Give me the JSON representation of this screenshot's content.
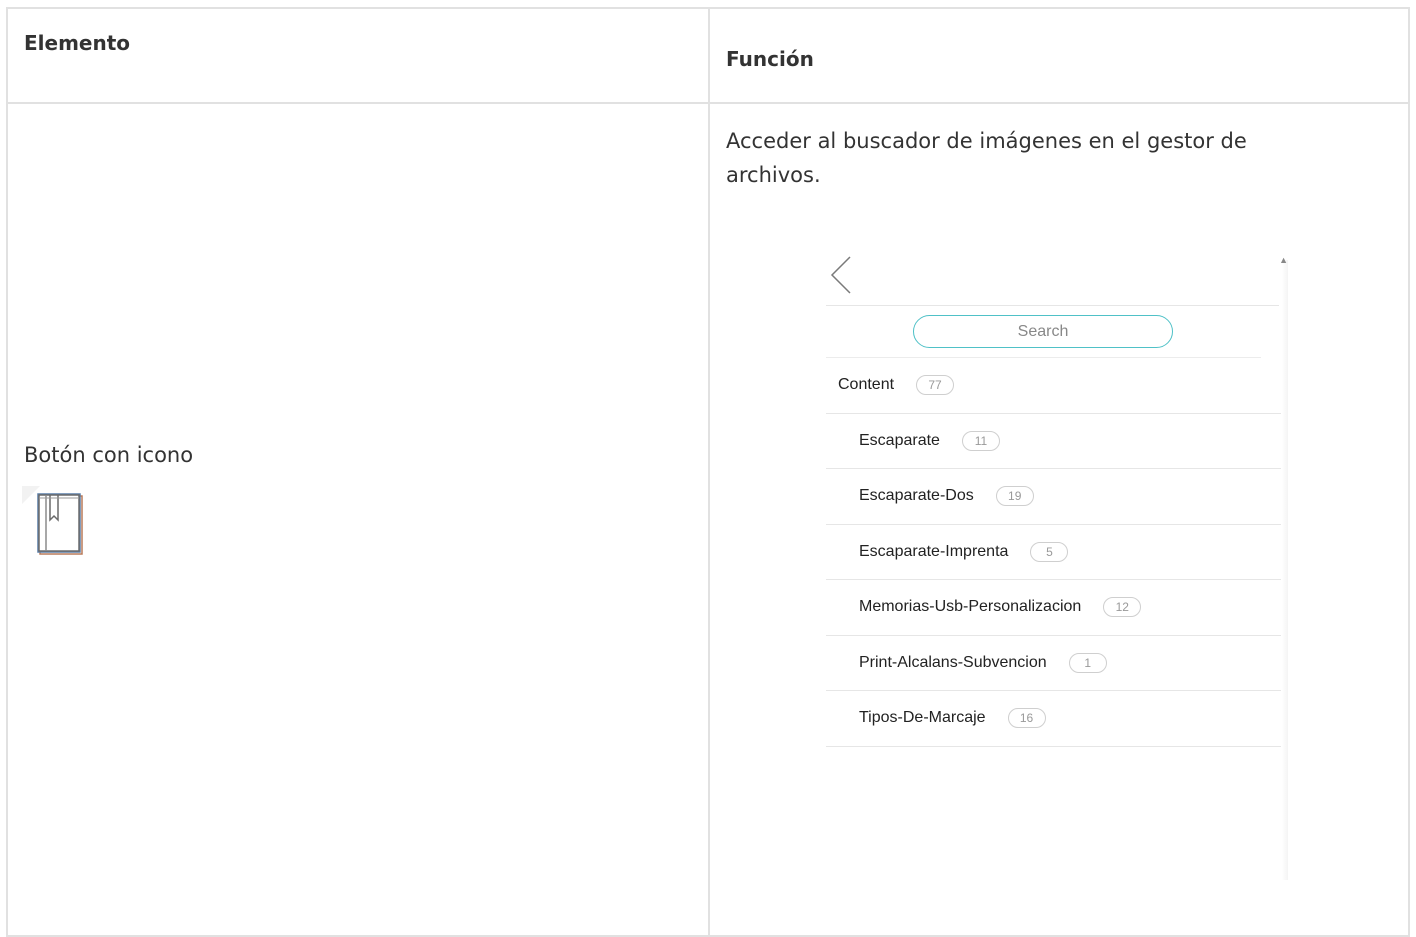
{
  "table": {
    "header_elemento": "Elemento",
    "header_funcion": "Función"
  },
  "row": {
    "elemento_label": "Botón con icono",
    "elemento_icon": "bookmark-book-icon",
    "funcion_text": "Acceder al buscador de imágenes en el gestor de archivos."
  },
  "file_manager": {
    "back_icon": "chevron-left-icon",
    "search": {
      "placeholder": "Search",
      "value": "Search"
    },
    "folders": [
      {
        "name": "Content",
        "count": "77",
        "level": "root"
      },
      {
        "name": "Escaparate",
        "count": "11",
        "level": "child"
      },
      {
        "name": "Escaparate-Dos",
        "count": "19",
        "level": "child"
      },
      {
        "name": "Escaparate-Imprenta",
        "count": "5",
        "level": "child"
      },
      {
        "name": "Memorias-Usb-Personalizacion",
        "count": "12",
        "level": "child"
      },
      {
        "name": "Print-Alcalans-Subvencion",
        "count": "1",
        "level": "child"
      },
      {
        "name": "Tipos-De-Marcaje",
        "count": "16",
        "level": "child"
      }
    ],
    "colors": {
      "search_border": "#4fc1c7",
      "divider": "#e6e6e6"
    }
  }
}
